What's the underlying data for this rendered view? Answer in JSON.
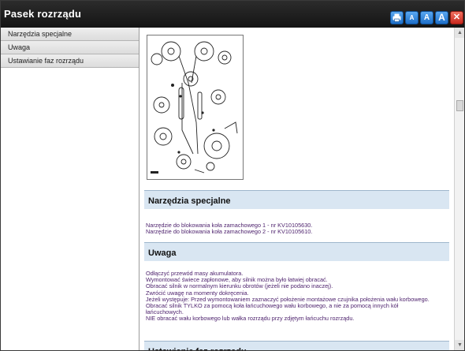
{
  "window": {
    "title": "Pasek rozrządu"
  },
  "toolbar": {
    "print_icon": "printer-icon",
    "font_small_label": "A",
    "font_medium_label": "A",
    "font_large_label": "A",
    "close_label": "✕"
  },
  "sidebar": {
    "items": [
      {
        "label": "Narzędzia specjalne"
      },
      {
        "label": "Uwaga"
      },
      {
        "label": "Ustawianie faz rozrządu"
      }
    ]
  },
  "content": {
    "diagram_label": "timing-chain-diagram",
    "sections": [
      {
        "heading": "Narzędzia specjalne",
        "lines": [
          "Narzędzie do blokowania koła zamachowego 1 - nr KV10105630.",
          "Narzędzie do blokowania koła zamachowego 2 - nr KV10105610."
        ]
      },
      {
        "heading": "Uwaga",
        "lines": [
          "Odłączyć przewód masy akumulatora.",
          "Wymontować świece zapłonowe, aby silnik można było łatwiej obracać.",
          "Obracać silnik w normalnym kierunku obrotów (jeżeli nie podano inaczej).",
          "Zwrócić uwagę na momenty dokręcenia.",
          "Jeżeli występuje: Przed wymontowaniem zaznaczyć położenie montażowe czujnika położenia wału korbowego.",
          "Obracać silnik TYLKO za pomocą koła łańcuchowego wału korbowego, a nie za pomocą innych kół",
          "łańcuchowych.",
          "NIE obracać wału korbowego lub wałka rozrządu przy zdjętym łańcuchu rozrządu."
        ]
      },
      {
        "heading": "Ustawianie faz rozrządu"
      }
    ]
  },
  "colors": {
    "titlebar": "#1e1e1e",
    "section_header": "#d9e6f2",
    "body_text": "#4b1f6b",
    "button_blue": "#2a7fd8",
    "button_red": "#d8322a"
  }
}
